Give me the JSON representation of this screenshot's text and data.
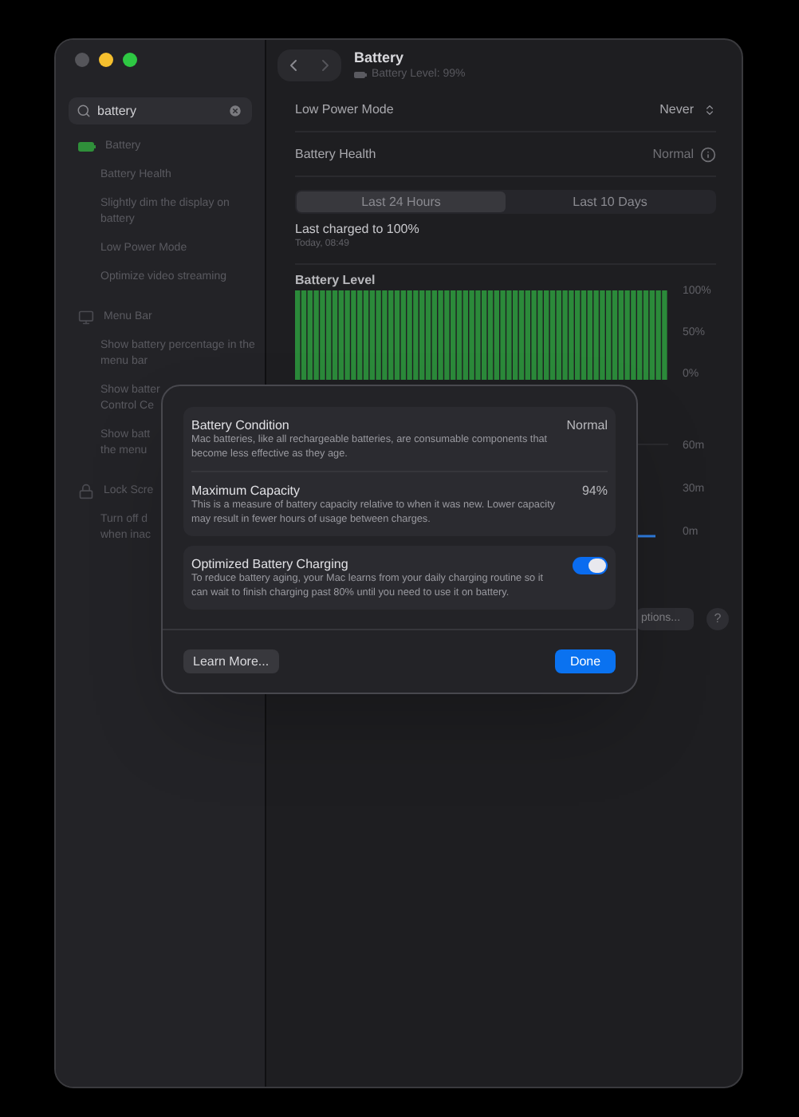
{
  "window": {
    "title": "Battery",
    "subtitle": "Battery Level: 99%"
  },
  "search": {
    "value": "battery"
  },
  "sidebar": {
    "sections": [
      {
        "title": "Battery",
        "kind": "battery",
        "items": [
          "Battery Health",
          "Slightly dim the display on battery",
          "Low Power Mode",
          "Optimize video streaming"
        ]
      },
      {
        "title": "Menu Bar",
        "kind": "menubar",
        "items": [
          "Show battery percentage in the menu bar",
          "Show batter\nControl Ce",
          "Show batt\nthe menu"
        ]
      },
      {
        "title": "Lock Scre",
        "kind": "lock",
        "items": [
          "Turn off d\nwhen inac"
        ]
      }
    ]
  },
  "settings": [
    {
      "label": "Low Power Mode",
      "value": "Never",
      "kind": "popup"
    },
    {
      "label": "Battery Health",
      "value": "Normal",
      "kind": "info"
    }
  ],
  "tabs": [
    {
      "label": "Last 24 Hours",
      "selected": true
    },
    {
      "label": "Last 10 Days",
      "selected": false
    }
  ],
  "last_charged": {
    "title": "Last charged to 100%",
    "time": "Today, 08:49"
  },
  "battery_chart": {
    "title": "Battery Level",
    "ticks": [
      "100%",
      "50%",
      "0%"
    ]
  },
  "usage_chart": {
    "ticks": [
      "60m",
      "30m",
      "0m"
    ]
  },
  "options_button": "ptions...",
  "help_button": "?",
  "dialog": {
    "groups": [
      [
        {
          "title": "Battery Condition",
          "description": "Mac batteries, like all rechargeable batteries, are consumable components that become less effective as they age.",
          "value": "Normal",
          "kind": "text"
        },
        {
          "title": "Maximum Capacity",
          "description": "This is a measure of battery capacity relative to when it was new. Lower capacity may result in fewer hours of usage between charges.",
          "value": "94%",
          "kind": "text"
        }
      ],
      [
        {
          "title": "Optimized Battery Charging",
          "description": "To reduce battery aging, your Mac learns from your daily charging routine so it can wait to finish charging past 80% until you need to use it on battery.",
          "on": true,
          "kind": "toggle"
        }
      ]
    ],
    "learn_more": "Learn More...",
    "done": "Done"
  }
}
